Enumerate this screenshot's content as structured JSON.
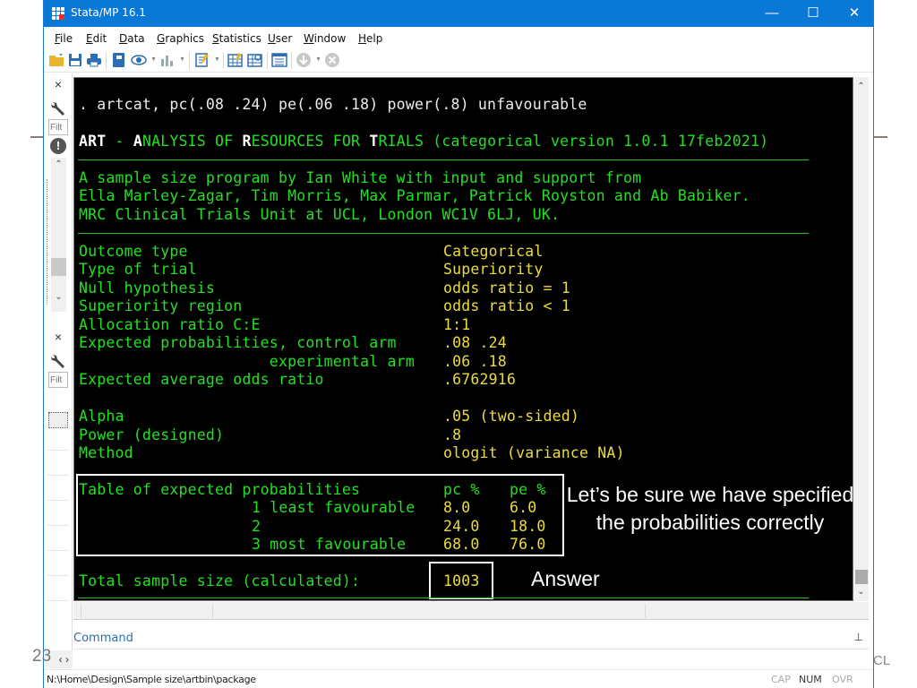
{
  "window": {
    "title": "Stata/MP 16.1",
    "controls": {
      "minimize": "—",
      "maximize": "☐",
      "close": "✕"
    }
  },
  "menu": [
    "File",
    "Edit",
    "Data",
    "Graphics",
    "Statistics",
    "User",
    "Window",
    "Help"
  ],
  "toolbar": {
    "icons": [
      "open-folder-icon",
      "save-icon",
      "print-icon",
      "log-icon",
      "viewer-icon",
      "graph-icon",
      "do-file-editor-icon",
      "data-editor-icon",
      "data-browser-icon",
      "variables-manager-icon",
      "more-icon",
      "break-icon"
    ]
  },
  "left_dock": {
    "close_glyph": "×",
    "filter_placeholder": "Filt",
    "alert_glyph": "!",
    "scroll_up": "⌃",
    "scroll_down": "⌄"
  },
  "results": {
    "command": ". artcat, pc(.08 .24) pe(.06 .18) power(.8) unfavourable",
    "banner": {
      "art": "ART",
      "dash": " - ",
      "a": "A",
      "nalysis": "NALYSIS OF ",
      "r": "R",
      "esources": "ESOURCES FOR ",
      "t": "T",
      "rials": "RIALS (categorical version 1.0.1 17feb2021)"
    },
    "credits": [
      "A sample size program by Ian White with input and support from",
      "Ella Marley-Zagar, Tim Morris, Max Parmar, Patrick Royston and Ab Babiker.",
      "MRC Clinical Trials Unit at UCL, London WC1V 6LJ, UK."
    ],
    "settings": [
      {
        "label": "Outcome type",
        "value": "Categorical"
      },
      {
        "label": "Type of trial",
        "value": "Superiority"
      },
      {
        "label": "Null hypothesis",
        "value": "odds ratio = 1"
      },
      {
        "label": "Superiority region",
        "value": "odds ratio < 1"
      },
      {
        "label": "Allocation ratio C:E",
        "value": "1:1"
      },
      {
        "label": "Expected probabilities, control arm",
        "value": ".08 .24"
      },
      {
        "label": "                     experimental arm",
        "value": ".06 .18"
      },
      {
        "label": "Expected average odds ratio",
        "value": ".6762916"
      }
    ],
    "test_settings": [
      {
        "label": "Alpha",
        "value": ".05 (two-sided)"
      },
      {
        "label": "Power (designed)",
        "value": ".8"
      },
      {
        "label": "Method",
        "value": "ologit (variance NA)"
      }
    ],
    "prob_table": {
      "title": "Table of expected probabilities",
      "col_pc": "pc %",
      "col_pe": "pe %",
      "rows": [
        {
          "label": "1 least favourable",
          "pc": "8.0",
          "pe": "6.0"
        },
        {
          "label": "2",
          "pc": "24.0",
          "pe": "18.0"
        },
        {
          "label": "3 most favourable",
          "pc": "68.0",
          "pe": "76.0"
        }
      ]
    },
    "total": {
      "label": "Total sample size (calculated):",
      "value": "1003"
    },
    "annotations": {
      "note": "Let’s be sure we have specified the probabilities correctly",
      "answer": "Answer"
    }
  },
  "command_pane": {
    "label": "Command",
    "pin": "⊥",
    "nav": "‹ ›"
  },
  "status": {
    "path": "N:\\Home\\Design\\Sample size\\artbin\\package",
    "cap": "CAP",
    "num": "NUM",
    "ovr": "OVR"
  },
  "slide": {
    "page_number": "23",
    "footer_fragment": "CL"
  },
  "colors": {
    "titlebar": "#0a78d7",
    "results_bg": "#000000",
    "output_green": "#22e022",
    "result_yellow": "#ecdc3c",
    "command_white": "#ececec",
    "command_label": "#2f6ea6"
  }
}
